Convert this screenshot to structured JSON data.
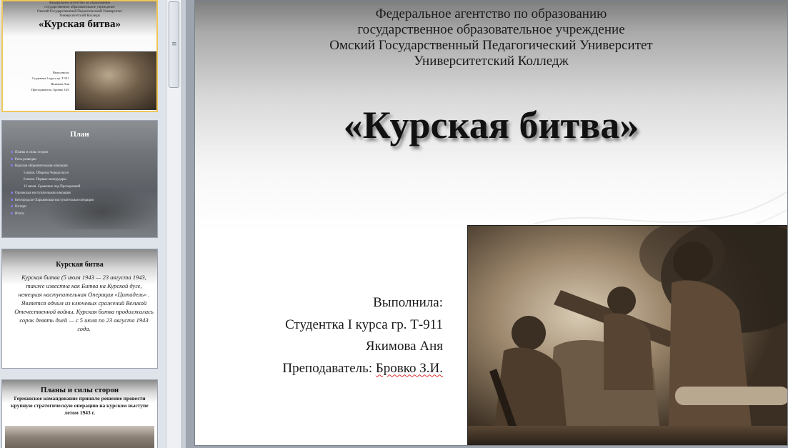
{
  "thumbnails": [
    {
      "header": [
        "Федеральное агентство по образованию",
        "государственное образовательное учреждение",
        "Омский Государственный Педагогический Университет",
        "Университетский Колледж"
      ],
      "title": "«Курская битва»",
      "author_lines": [
        "Выполнила:",
        "Студентка I курса гр. Т-911",
        "Якимова Аня",
        "Преподаватель: Бровко З.И."
      ]
    },
    {
      "title": "План",
      "items": [
        {
          "text": "Планы и силы сторон",
          "sub": false
        },
        {
          "text": "Роль разведки",
          "sub": false
        },
        {
          "text": "Курская оборонительная операция",
          "sub": false
        },
        {
          "text": "5 июля. Оборона Черкасского",
          "sub": true
        },
        {
          "text": "6 июля. Первые контрудары",
          "sub": true
        },
        {
          "text": "12 июля. Сражение под Прохоровкой",
          "sub": true
        },
        {
          "text": "Орловская наступательная операция",
          "sub": false
        },
        {
          "text": "Белгородско-Харьковская наступательная операция",
          "sub": false
        },
        {
          "text": "Потери",
          "sub": false
        },
        {
          "text": "Итоги",
          "sub": false
        }
      ]
    },
    {
      "title": "Курская битва",
      "body": "Курская битва (5 июля 1943 — 23 августа 1943, также известна как Битва на Курской дуге, немецкая наступательная Операция «Цитадель» . Является одним из ключевых сражений Великой Отечественной войны. Курская битва продолжалась сорок девять дней — с 5 июля по 23 августа 1943 года."
    },
    {
      "title": "Планы и силы сторон",
      "body": "Германское командование приняло решение провести крупную стратегическую операцию на курском выступе летом 1943 г."
    }
  ],
  "slide": {
    "header": [
      "Федеральное агентство по образованию",
      "государственное образовательное учреждение",
      "Омский Государственный Педагогический Университет",
      "Университетский Колледж"
    ],
    "title": "«Курская битва»",
    "author": {
      "label": "Выполнила:",
      "student": "Студентка I курса гр. Т-911",
      "name": "Якимова Аня",
      "teacher_label": "Преподаватель: ",
      "teacher_name": "Бровко З.И."
    }
  },
  "scrollbar": {
    "grip": "≡"
  },
  "colors": {
    "selected_border": "#f0c75a",
    "bullet": "#9a7cff",
    "spell_underline": "#e03030"
  }
}
